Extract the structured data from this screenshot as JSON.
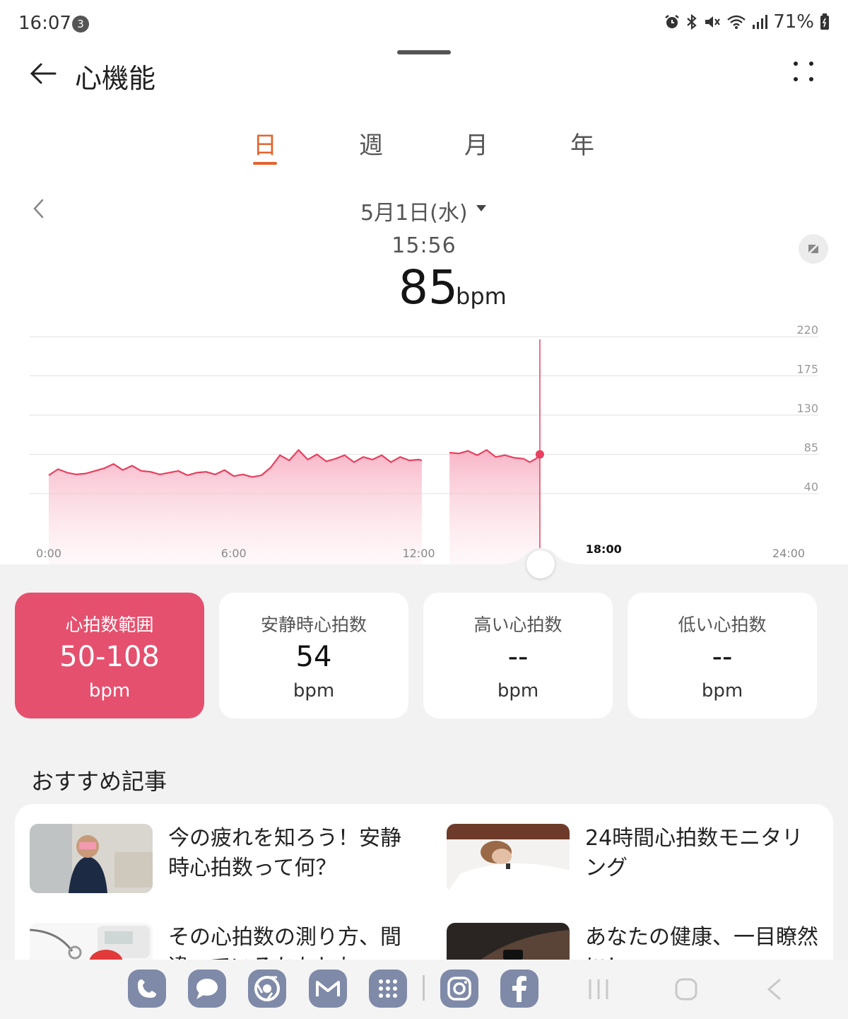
{
  "status_bar": {
    "time": "16:07",
    "notification_count": "3",
    "battery": "71%",
    "icons": [
      "alarm-icon",
      "bluetooth-icon",
      "mute-icon",
      "wifi-icon",
      "signal-icon",
      "battery-icon"
    ]
  },
  "header": {
    "title": "心機能",
    "back_icon": "arrow-left-icon",
    "more_icon": "more-dots-icon"
  },
  "tabs": [
    {
      "label": "日",
      "active": true
    },
    {
      "label": "週",
      "active": false
    },
    {
      "label": "月",
      "active": false
    },
    {
      "label": "年",
      "active": false
    }
  ],
  "date_nav": {
    "date": "5月1日(水)",
    "selected_time": "15:56",
    "bpm_value": "85",
    "bpm_unit": "bpm"
  },
  "chart_data": {
    "type": "area",
    "x_unit": "hour",
    "xlim": [
      0,
      24
    ],
    "ylim": [
      40,
      220
    ],
    "y_ticks": [
      "220",
      "175",
      "130",
      "85",
      "40"
    ],
    "x_ticks": [
      "0:00",
      "6:00",
      "12:00",
      "18:00",
      "24:00"
    ],
    "highlight_x_tick": "18:00",
    "color": "#e8405f",
    "selected_point": {
      "x": 15.93,
      "y": 85
    },
    "segments": [
      {
        "x": [
          0,
          0.3,
          0.6,
          0.9,
          1.2,
          1.5,
          1.8,
          2.1,
          2.4,
          2.7,
          3.0,
          3.3,
          3.6,
          3.9,
          4.2,
          4.5,
          4.8,
          5.1,
          5.4,
          5.7,
          6.0,
          6.3,
          6.6,
          6.9,
          7.2,
          7.5,
          7.8,
          8.1,
          8.4,
          8.7,
          9.0,
          9.3,
          9.6,
          9.9,
          10.2,
          10.5,
          10.8,
          11.1,
          11.4,
          11.7,
          12.0,
          12.1
        ],
        "y": [
          61,
          68,
          64,
          62,
          63,
          66,
          69,
          74,
          67,
          72,
          66,
          65,
          62,
          64,
          66,
          61,
          64,
          65,
          62,
          67,
          60,
          62,
          59,
          61,
          70,
          84,
          78,
          90,
          79,
          85,
          77,
          80,
          84,
          76,
          82,
          79,
          84,
          76,
          82,
          78,
          79,
          78
        ]
      },
      {
        "x": [
          13.0,
          13.3,
          13.6,
          13.9,
          14.2,
          14.5,
          14.8,
          15.1,
          15.4,
          15.6,
          15.8,
          15.93
        ],
        "y": [
          87,
          86,
          89,
          84,
          90,
          82,
          84,
          81,
          80,
          76,
          80,
          85
        ]
      }
    ]
  },
  "summary_cards": [
    {
      "title": "心拍数範囲",
      "value": "50-108",
      "unit": "bpm",
      "active": true
    },
    {
      "title": "安静時心拍数",
      "value": "54",
      "unit": "bpm",
      "active": false
    },
    {
      "title": "高い心拍数",
      "value": "--",
      "unit": "bpm",
      "active": false
    },
    {
      "title": "低い心拍数",
      "value": "--",
      "unit": "bpm",
      "active": false
    }
  ],
  "recommended": {
    "title": "おすすめ記事",
    "articles": [
      {
        "text": "今の疲れを知ろう！安静時心拍数って何？"
      },
      {
        "text": "24時間心拍数モニタリング"
      },
      {
        "text": "その心拍数の測り方、間違っているかもしれ"
      },
      {
        "text": "あなたの健康、一目瞭然に！"
      }
    ]
  },
  "dock": {
    "apps": [
      "phone-icon",
      "messages-icon",
      "chrome-icon",
      "gmail-icon",
      "apps-grid-icon",
      "instagram-icon",
      "facebook-icon"
    ],
    "nav": [
      "recents-icon",
      "home-icon",
      "back-nav-icon"
    ]
  }
}
